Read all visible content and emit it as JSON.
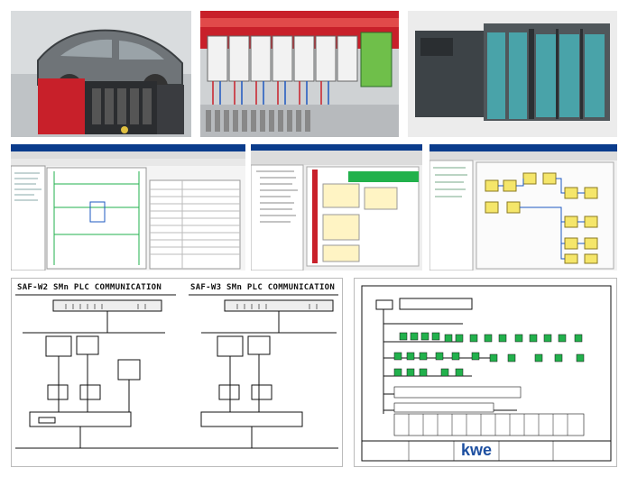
{
  "collage": {
    "diagram_left_title": "SAF-W2 SMn PLC COMMUNICATION",
    "diagram_mid_title": "SAF-W3 SMn PLC COMMUNICATION",
    "brand_logo_text": "kwe"
  },
  "colors": {
    "rail_red": "#c8202a",
    "plc_teal": "#49a3a9",
    "ladder_green": "#22b14c",
    "diagram_line": "#111111",
    "app_window_blue": "#0a3c8c"
  },
  "icons": [
    "car-body-icon",
    "plc-rack-icon",
    "terminal-block-icon",
    "network-switch-icon"
  ]
}
